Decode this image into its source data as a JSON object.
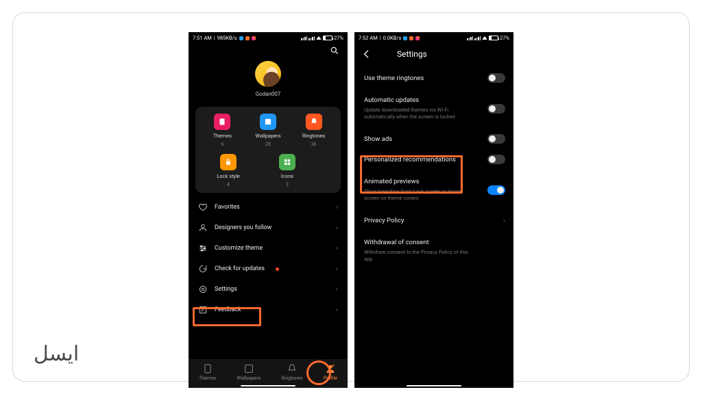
{
  "left": {
    "status": {
      "time": "7:51 AM",
      "net": "985KB/s",
      "batt": "27%"
    },
    "username": "Godan007",
    "tiles": [
      {
        "label": "Themes",
        "count": "6",
        "color": "#e91e63"
      },
      {
        "label": "Wallpapers",
        "count": "28",
        "color": "#2196f3"
      },
      {
        "label": "Ringtones",
        "count": "36",
        "color": "#ff5722"
      },
      {
        "label": "Lock style",
        "count": "4",
        "color": "#ff9800"
      },
      {
        "label": "Icons",
        "count": "3",
        "color": "#4caf50"
      }
    ],
    "menu": {
      "favorites": "Favorites",
      "designers": "Designers you follow",
      "customize": "Customize theme",
      "updates": "Check for updates",
      "settings": "Settings",
      "feedback": "Feedback"
    },
    "nav": {
      "themes": "Themes",
      "wallpapers": "Wallpapers",
      "ringtones": "Ringtones",
      "profile": "Profile"
    }
  },
  "right": {
    "status": {
      "time": "7:52 AM",
      "net": "0.0KB/s",
      "batt": "27%"
    },
    "title": "Settings",
    "rows": {
      "ringtones": {
        "t": "Use theme ringtones"
      },
      "auto": {
        "t": "Automatic updates",
        "d": "Update downloaded themes via Wi-Fi automatically when the screen is locked"
      },
      "ads": {
        "t": "Show ads"
      },
      "pers": {
        "t": "Personalized recommendations"
      },
      "anim": {
        "t": "Animated previews",
        "d": "Show transition from Lock screen to Home screen on theme covers"
      },
      "privacy": {
        "t": "Privacy Policy"
      },
      "withdraw": {
        "t": "Withdrawal of consent",
        "d": "Withdraw consent to the Privacy Policy of this app"
      }
    }
  },
  "brand": "ایسل"
}
